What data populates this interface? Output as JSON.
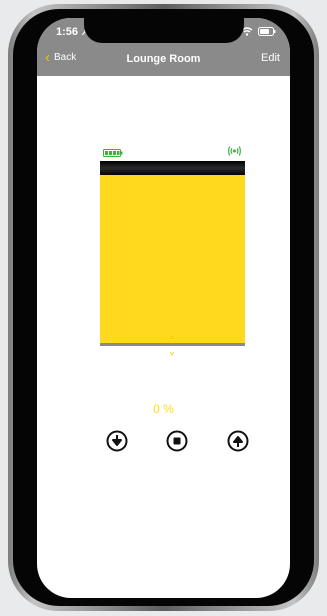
{
  "status_bar": {
    "time": "1:56"
  },
  "nav": {
    "back_label": "Back",
    "title": "Lounge Room",
    "edit_label": "Edit"
  },
  "device": {
    "battery_icon": "battery-full-icon",
    "signal_icon": "wireless-signal-icon",
    "position_percent": "0 %",
    "blind_color": "#ffd91e"
  },
  "controls": [
    {
      "name": "move-down-button",
      "icon": "arrow-down-circle-icon"
    },
    {
      "name": "stop-button",
      "icon": "stop-circle-icon"
    },
    {
      "name": "move-up-button",
      "icon": "arrow-up-circle-icon"
    }
  ]
}
